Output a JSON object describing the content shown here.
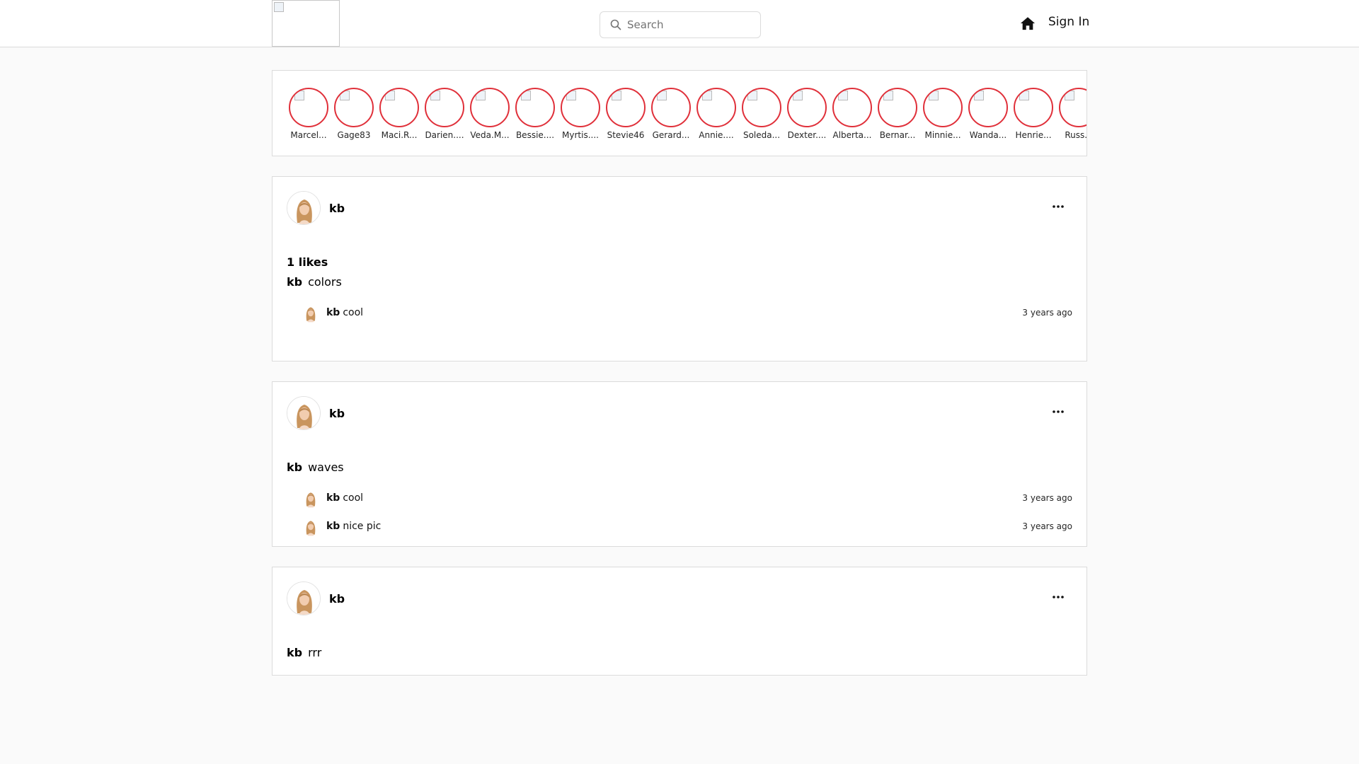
{
  "header": {
    "search_placeholder": "Search",
    "signin_label": "Sign In",
    "home_icon": "home-icon",
    "search_icon": "search-icon"
  },
  "stories": [
    {
      "name": "Marcel..."
    },
    {
      "name": "Gage83"
    },
    {
      "name": "Maci.R..."
    },
    {
      "name": "Darien...."
    },
    {
      "name": "Veda.M..."
    },
    {
      "name": "Bessie...."
    },
    {
      "name": "Myrtis...."
    },
    {
      "name": "Stevie46"
    },
    {
      "name": "Gerard..."
    },
    {
      "name": "Annie...."
    },
    {
      "name": "Soleda..."
    },
    {
      "name": "Dexter...."
    },
    {
      "name": "Alberta..."
    },
    {
      "name": "Bernar..."
    },
    {
      "name": "Minnie..."
    },
    {
      "name": "Wanda..."
    },
    {
      "name": "Henrie..."
    },
    {
      "name": "Russ.S"
    }
  ],
  "posts": [
    {
      "user": "kb",
      "likes": "1 likes",
      "caption_user": "kb",
      "caption_text": "colors",
      "comments": [
        {
          "user": "kb",
          "text": "cool",
          "ago": "3 years ago"
        }
      ]
    },
    {
      "user": "kb",
      "caption_user": "kb",
      "caption_text": "waves",
      "comments": [
        {
          "user": "kb",
          "text": "cool",
          "ago": "3 years ago"
        },
        {
          "user": "kb",
          "text": "nice pic",
          "ago": "3 years ago"
        }
      ]
    },
    {
      "user": "kb",
      "caption_user": "kb",
      "caption_text": "rrr",
      "comments": []
    }
  ],
  "colors": {
    "story_ring": "#e0303a",
    "border": "#dbdbdb",
    "background": "#fafafa"
  }
}
